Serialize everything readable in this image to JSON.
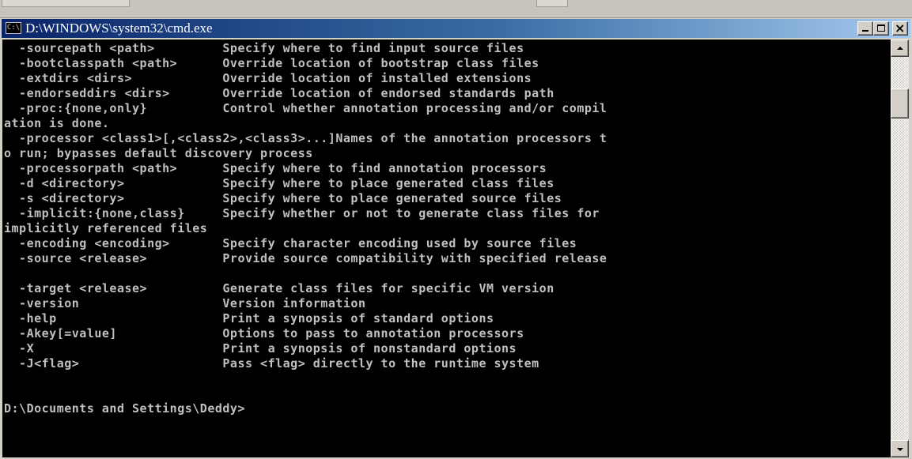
{
  "window": {
    "title": "D:\\WINDOWS\\system32\\cmd.exe",
    "icon_label": "C:\\",
    "buttons": {
      "minimize": "minimize-icon",
      "maximize": "maximize-icon",
      "close": "close-icon"
    }
  },
  "console": {
    "foreground": "#c0c0c0",
    "background": "#000000",
    "lines": [
      "  -sourcepath <path>         Specify where to find input source files",
      "  -bootclasspath <path>      Override location of bootstrap class files",
      "  -extdirs <dirs>            Override location of installed extensions",
      "  -endorseddirs <dirs>       Override location of endorsed standards path",
      "  -proc:{none,only}          Control whether annotation processing and/or compil",
      "ation is done.",
      "  -processor <class1>[,<class2>,<class3>...]Names of the annotation processors t",
      "o run; bypasses default discovery process",
      "  -processorpath <path>      Specify where to find annotation processors",
      "  -d <directory>             Specify where to place generated class files",
      "  -s <directory>             Specify where to place generated source files",
      "  -implicit:{none,class}     Specify whether or not to generate class files for",
      "implicitly referenced files",
      "  -encoding <encoding>       Specify character encoding used by source files",
      "  -source <release>          Provide source compatibility with specified release",
      "",
      "  -target <release>          Generate class files for specific VM version",
      "  -version                   Version information",
      "  -help                      Print a synopsis of standard options",
      "  -Akey[=value]              Options to pass to annotation processors",
      "  -X                         Print a synopsis of nonstandard options",
      "  -J<flag>                   Pass <flag> directly to the runtime system",
      "",
      "",
      "D:\\Documents and Settings\\Deddy>"
    ]
  },
  "scrollbar": {
    "up": "scroll-up-arrow-icon",
    "down": "scroll-down-arrow-icon"
  }
}
